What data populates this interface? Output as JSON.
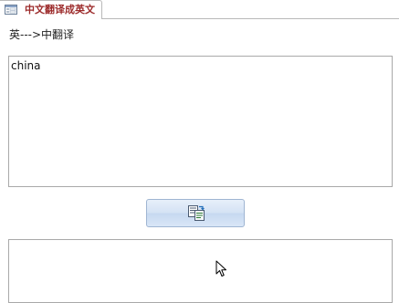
{
  "tab": {
    "title": "中文翻译成英文",
    "icon": "form-icon"
  },
  "direction_label": "英--->中翻译",
  "input": {
    "value": "china"
  },
  "translate_button": {
    "icon": "translate-icon"
  },
  "output": {
    "value": ""
  },
  "colors": {
    "tab_title": "#9c2b2b",
    "button_border": "#9fb5d2",
    "button_fill": "#d4e2f4",
    "box_border": "#a9a9a9"
  }
}
